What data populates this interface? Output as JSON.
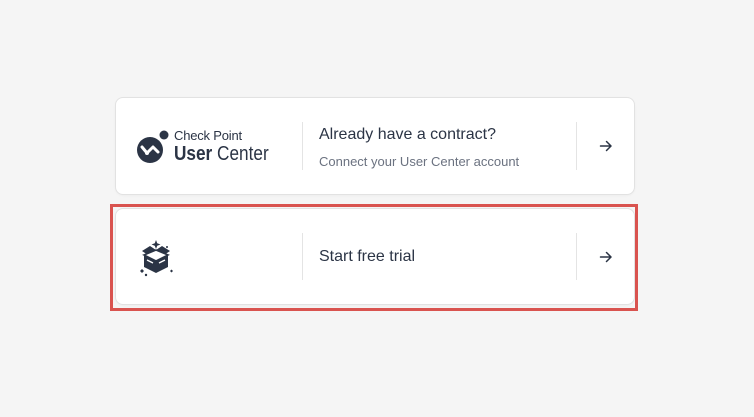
{
  "colors": {
    "background": "#f5f5f5",
    "card_background": "#ffffff",
    "text_primary": "#2b3445",
    "text_secondary": "#6b7280",
    "highlight_border": "#d9534f"
  },
  "cards": [
    {
      "id": "contract",
      "logo": {
        "icon": "check-point-logo-icon",
        "brand_line1": "Check Point",
        "brand_line2_bold": "User",
        "brand_line2_regular": "Center"
      },
      "title": "Already have a contract?",
      "subtitle": "Connect your User Center account",
      "arrow_icon": "arrow-right-icon"
    },
    {
      "id": "trial",
      "logo": {
        "icon": "gift-box-icon"
      },
      "title": "Start free trial",
      "arrow_icon": "arrow-right-icon",
      "highlighted": true
    }
  ]
}
